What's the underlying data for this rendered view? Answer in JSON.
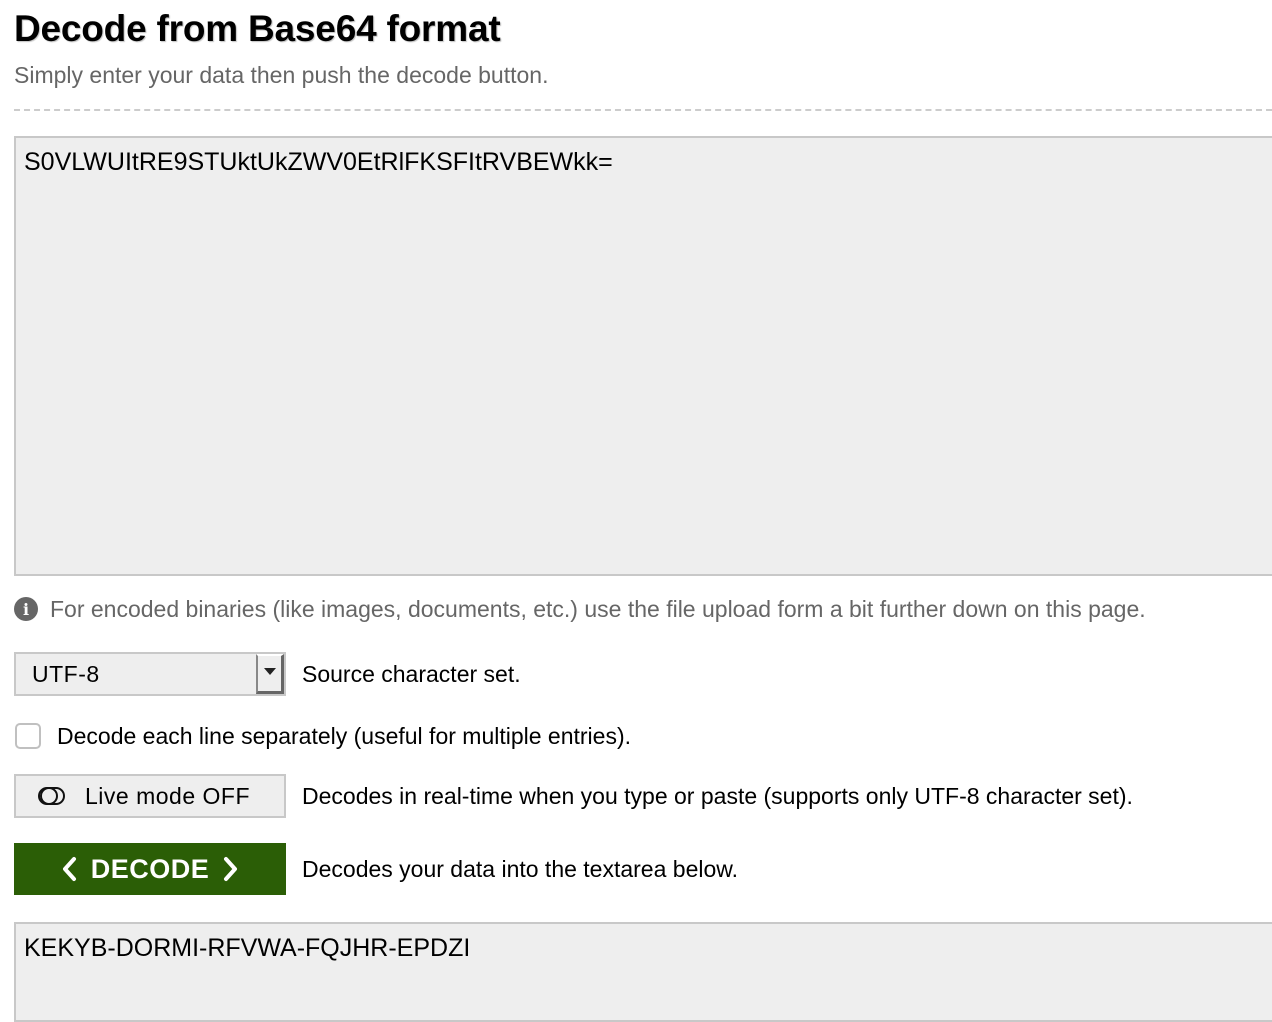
{
  "header": {
    "title": "Decode from Base64 format",
    "subtitle": "Simply enter your data then push the decode button."
  },
  "input": {
    "value": "S0VLWUItRE9STUktUkZWV0EtRlFKSFItRVBEWkk="
  },
  "info": {
    "icon": "info-icon",
    "text": "For encoded binaries (like images, documents, etc.) use the file upload form a bit further down on this page."
  },
  "charset": {
    "selected": "UTF-8",
    "label": "Source character set."
  },
  "line_option": {
    "checked": false,
    "label": "Decode each line separately (useful for multiple entries)."
  },
  "live_mode": {
    "button_label": "Live mode OFF",
    "description": "Decodes in real-time when you type or paste (supports only UTF-8 character set)."
  },
  "decode": {
    "button_label": "DECODE",
    "description": "Decodes your data into the textarea below.",
    "color": "#2b5e06"
  },
  "output": {
    "value": "KEKYB-DORMI-RFVWA-FQJHR-EPDZI"
  }
}
